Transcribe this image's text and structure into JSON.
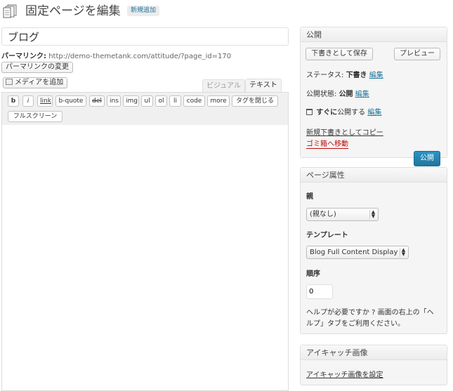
{
  "header": {
    "title": "固定ページを編集",
    "add_new": "新規追加"
  },
  "editor": {
    "title_value": "ブログ",
    "permalink_label": "パーマリンク:",
    "permalink_url": "http://demo-themetank.com/attitude/?page_id=170",
    "change_permalink_button": "パーマリンクの変更",
    "add_media_button": "メディアを追加",
    "tab_visual": "ビジュアル",
    "tab_text": "テキスト",
    "quicktags": [
      "b",
      "i",
      "link",
      "b-quote",
      "del",
      "ins",
      "img",
      "ul",
      "ol",
      "li",
      "code",
      "more",
      "タグを閉じる"
    ],
    "fullscreen_button": "フルスクリーン"
  },
  "publish": {
    "heading": "公開",
    "save_draft_button": "下書きとして保存",
    "preview_button": "プレビュー",
    "status_label": "ステータス:",
    "status_value": "下書き",
    "visibility_label": "公開状態:",
    "visibility_value": "公開",
    "schedule_prefix": "すぐに",
    "schedule_suffix": "公開する",
    "edit_link": "編集",
    "copy_draft_link": "新規下書きとしてコピー",
    "trash_link": "ゴミ箱へ移動",
    "publish_button": "公開"
  },
  "page_attributes": {
    "heading": "ページ属性",
    "parent_label": "親",
    "parent_value": "(親なし)",
    "template_label": "テンプレート",
    "template_value": "Blog Full Content Display",
    "order_label": "順序",
    "order_value": "0",
    "help_text_line1": "ヘルプが必要ですか ? 画面の右上の「ヘ",
    "help_text_line2": "ルプ」タブをご利用ください。"
  },
  "featured_image": {
    "heading": "アイキャッチ画像",
    "set_link": "アイキャッチ画像を設定"
  }
}
